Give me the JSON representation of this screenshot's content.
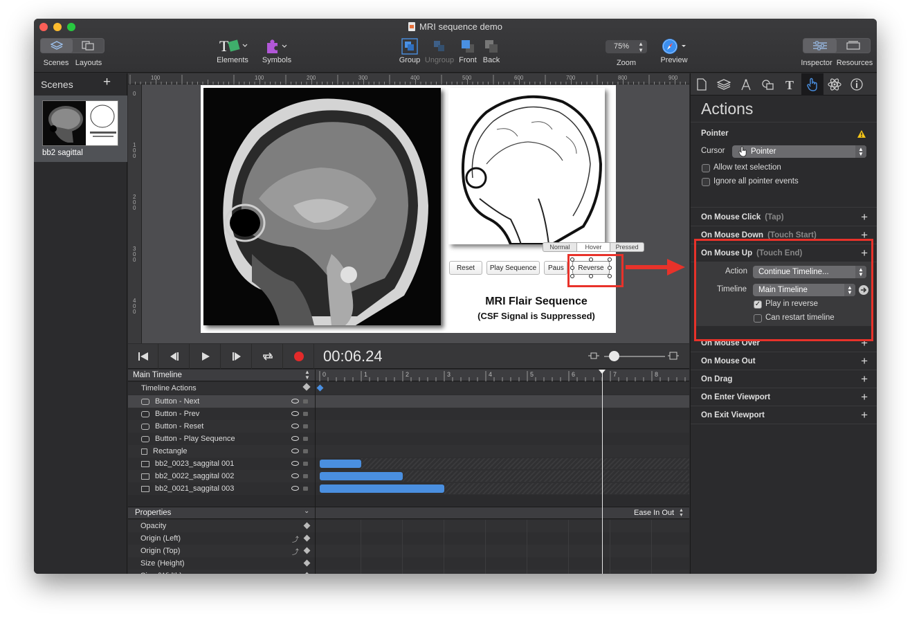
{
  "window": {
    "title": "MRI sequence demo"
  },
  "toolbar": {
    "scenes": "Scenes",
    "layouts": "Layouts",
    "elements": "Elements",
    "symbols": "Symbols",
    "group": "Group",
    "ungroup": "Ungroup",
    "front": "Front",
    "back": "Back",
    "zoom_value": "75%",
    "zoom": "Zoom",
    "preview": "Preview",
    "inspector": "Inspector",
    "resources": "Resources"
  },
  "scenes_panel": {
    "header": "Scenes",
    "add": "+",
    "scene_name": "bb2 sagittal"
  },
  "ruler": {
    "top": [
      "100",
      "100",
      "200",
      "300",
      "400",
      "500",
      "600",
      "700",
      "800",
      "900"
    ],
    "left": [
      "0",
      "100",
      "200",
      "300",
      "400"
    ]
  },
  "canvas": {
    "title": "MRI Flair Sequence",
    "subtitle": "(CSF Signal is Suppressed)",
    "states": [
      "Normal",
      "Hover",
      "Pressed"
    ],
    "buttons": {
      "reset": "Reset",
      "play": "Play Sequence",
      "pause": "Paus",
      "reverse": "Reverse"
    }
  },
  "timeline": {
    "time": "00:06.24",
    "header": "Main Timeline",
    "actions": "Timeline Actions",
    "ticks": [
      "0",
      "1",
      "2",
      "3",
      "4",
      "5",
      "6",
      "7",
      "8"
    ],
    "rows": [
      {
        "name": "Button - Next",
        "type": "button",
        "bar": null
      },
      {
        "name": "Button - Prev",
        "type": "button",
        "bar": null
      },
      {
        "name": "Button - Reset",
        "type": "button",
        "bar": null
      },
      {
        "name": "Button - Play Sequence",
        "type": "button",
        "bar": null
      },
      {
        "name": "Rectangle",
        "type": "rect",
        "bar": null
      },
      {
        "name": "bb2_0023_saggital 001",
        "type": "image",
        "bar": 1
      },
      {
        "name": "bb2_0022_saggital 002",
        "type": "image",
        "bar": 2
      },
      {
        "name": "bb2_0021_saggital 003",
        "type": "image",
        "bar": 3
      }
    ],
    "properties_header": "Properties",
    "easing": "Ease In Out",
    "properties": [
      "Opacity",
      "Origin (Left)",
      "Origin (Top)",
      "Size (Height)",
      "Size (Width)"
    ]
  },
  "inspector": {
    "title": "Actions",
    "pointer_section": "Pointer",
    "cursor_label": "Cursor",
    "cursor_value": "Pointer",
    "allow_text": "Allow text selection",
    "ignore_events": "Ignore all pointer events",
    "events": {
      "click": "On Mouse Click",
      "click_sub": "(Tap)",
      "down": "On Mouse Down",
      "down_sub": "(Touch Start)",
      "up": "On Mouse Up",
      "up_sub": "(Touch End)",
      "over": "On Mouse Over",
      "out": "On Mouse Out",
      "drag": "On Drag",
      "enter": "On Enter Viewport",
      "exit": "On Exit Viewport"
    },
    "action_label": "Action",
    "action_value": "Continue Timeline...",
    "timeline_label": "Timeline",
    "timeline_value": "Main Timeline",
    "play_reverse": "Play in reverse",
    "play_reverse_checked": true,
    "can_restart": "Can restart timeline",
    "can_restart_checked": false
  },
  "colors": {
    "highlight": "#e8322a",
    "accent": "#4a90e2"
  }
}
